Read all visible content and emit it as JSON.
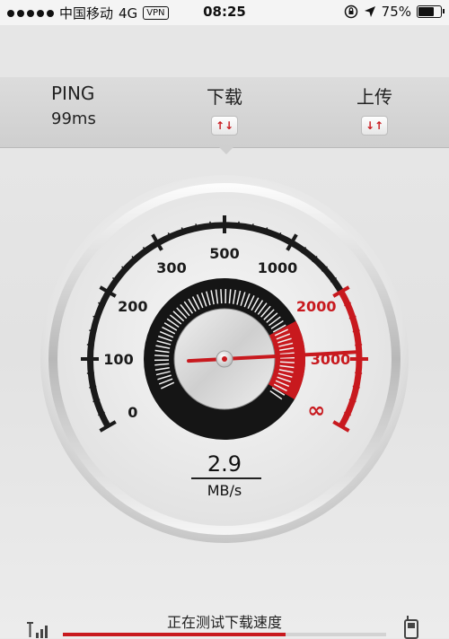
{
  "status_bar": {
    "carrier": "中国移动",
    "network": "4G",
    "vpn": "VPN",
    "time": "08:25",
    "battery_percent": "75%",
    "battery_level": 0.75
  },
  "metrics": {
    "ping": {
      "label": "PING",
      "value": "99ms"
    },
    "download": {
      "label": "下载",
      "icon": "down-up-arrows-icon"
    },
    "upload": {
      "label": "上传",
      "icon": "down-up-arrows-icon"
    }
  },
  "gauge": {
    "scale_labels": [
      "0",
      "100",
      "200",
      "300",
      "500",
      "1000",
      "2000",
      "3000",
      "∞"
    ],
    "current_value": "2.9",
    "unit": "MB/s",
    "needle_value_position": "3000",
    "accent_color": "#c8191e"
  },
  "bottom": {
    "status_text": "正在测试下载速度",
    "progress": 0.69
  }
}
